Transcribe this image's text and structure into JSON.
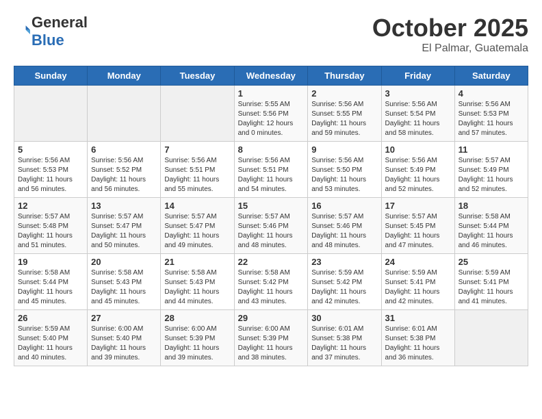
{
  "header": {
    "logo_general": "General",
    "logo_blue": "Blue",
    "month": "October 2025",
    "location": "El Palmar, Guatemala"
  },
  "days_of_week": [
    "Sunday",
    "Monday",
    "Tuesday",
    "Wednesday",
    "Thursday",
    "Friday",
    "Saturday"
  ],
  "weeks": [
    [
      {
        "day": "",
        "sunrise": "",
        "sunset": "",
        "daylight": ""
      },
      {
        "day": "",
        "sunrise": "",
        "sunset": "",
        "daylight": ""
      },
      {
        "day": "",
        "sunrise": "",
        "sunset": "",
        "daylight": ""
      },
      {
        "day": "1",
        "sunrise": "Sunrise: 5:55 AM",
        "sunset": "Sunset: 5:56 PM",
        "daylight": "Daylight: 12 hours and 0 minutes."
      },
      {
        "day": "2",
        "sunrise": "Sunrise: 5:56 AM",
        "sunset": "Sunset: 5:55 PM",
        "daylight": "Daylight: 11 hours and 59 minutes."
      },
      {
        "day": "3",
        "sunrise": "Sunrise: 5:56 AM",
        "sunset": "Sunset: 5:54 PM",
        "daylight": "Daylight: 11 hours and 58 minutes."
      },
      {
        "day": "4",
        "sunrise": "Sunrise: 5:56 AM",
        "sunset": "Sunset: 5:53 PM",
        "daylight": "Daylight: 11 hours and 57 minutes."
      }
    ],
    [
      {
        "day": "5",
        "sunrise": "Sunrise: 5:56 AM",
        "sunset": "Sunset: 5:53 PM",
        "daylight": "Daylight: 11 hours and 56 minutes."
      },
      {
        "day": "6",
        "sunrise": "Sunrise: 5:56 AM",
        "sunset": "Sunset: 5:52 PM",
        "daylight": "Daylight: 11 hours and 56 minutes."
      },
      {
        "day": "7",
        "sunrise": "Sunrise: 5:56 AM",
        "sunset": "Sunset: 5:51 PM",
        "daylight": "Daylight: 11 hours and 55 minutes."
      },
      {
        "day": "8",
        "sunrise": "Sunrise: 5:56 AM",
        "sunset": "Sunset: 5:51 PM",
        "daylight": "Daylight: 11 hours and 54 minutes."
      },
      {
        "day": "9",
        "sunrise": "Sunrise: 5:56 AM",
        "sunset": "Sunset: 5:50 PM",
        "daylight": "Daylight: 11 hours and 53 minutes."
      },
      {
        "day": "10",
        "sunrise": "Sunrise: 5:56 AM",
        "sunset": "Sunset: 5:49 PM",
        "daylight": "Daylight: 11 hours and 52 minutes."
      },
      {
        "day": "11",
        "sunrise": "Sunrise: 5:57 AM",
        "sunset": "Sunset: 5:49 PM",
        "daylight": "Daylight: 11 hours and 52 minutes."
      }
    ],
    [
      {
        "day": "12",
        "sunrise": "Sunrise: 5:57 AM",
        "sunset": "Sunset: 5:48 PM",
        "daylight": "Daylight: 11 hours and 51 minutes."
      },
      {
        "day": "13",
        "sunrise": "Sunrise: 5:57 AM",
        "sunset": "Sunset: 5:47 PM",
        "daylight": "Daylight: 11 hours and 50 minutes."
      },
      {
        "day": "14",
        "sunrise": "Sunrise: 5:57 AM",
        "sunset": "Sunset: 5:47 PM",
        "daylight": "Daylight: 11 hours and 49 minutes."
      },
      {
        "day": "15",
        "sunrise": "Sunrise: 5:57 AM",
        "sunset": "Sunset: 5:46 PM",
        "daylight": "Daylight: 11 hours and 48 minutes."
      },
      {
        "day": "16",
        "sunrise": "Sunrise: 5:57 AM",
        "sunset": "Sunset: 5:46 PM",
        "daylight": "Daylight: 11 hours and 48 minutes."
      },
      {
        "day": "17",
        "sunrise": "Sunrise: 5:57 AM",
        "sunset": "Sunset: 5:45 PM",
        "daylight": "Daylight: 11 hours and 47 minutes."
      },
      {
        "day": "18",
        "sunrise": "Sunrise: 5:58 AM",
        "sunset": "Sunset: 5:44 PM",
        "daylight": "Daylight: 11 hours and 46 minutes."
      }
    ],
    [
      {
        "day": "19",
        "sunrise": "Sunrise: 5:58 AM",
        "sunset": "Sunset: 5:44 PM",
        "daylight": "Daylight: 11 hours and 45 minutes."
      },
      {
        "day": "20",
        "sunrise": "Sunrise: 5:58 AM",
        "sunset": "Sunset: 5:43 PM",
        "daylight": "Daylight: 11 hours and 45 minutes."
      },
      {
        "day": "21",
        "sunrise": "Sunrise: 5:58 AM",
        "sunset": "Sunset: 5:43 PM",
        "daylight": "Daylight: 11 hours and 44 minutes."
      },
      {
        "day": "22",
        "sunrise": "Sunrise: 5:58 AM",
        "sunset": "Sunset: 5:42 PM",
        "daylight": "Daylight: 11 hours and 43 minutes."
      },
      {
        "day": "23",
        "sunrise": "Sunrise: 5:59 AM",
        "sunset": "Sunset: 5:42 PM",
        "daylight": "Daylight: 11 hours and 42 minutes."
      },
      {
        "day": "24",
        "sunrise": "Sunrise: 5:59 AM",
        "sunset": "Sunset: 5:41 PM",
        "daylight": "Daylight: 11 hours and 42 minutes."
      },
      {
        "day": "25",
        "sunrise": "Sunrise: 5:59 AM",
        "sunset": "Sunset: 5:41 PM",
        "daylight": "Daylight: 11 hours and 41 minutes."
      }
    ],
    [
      {
        "day": "26",
        "sunrise": "Sunrise: 5:59 AM",
        "sunset": "Sunset: 5:40 PM",
        "daylight": "Daylight: 11 hours and 40 minutes."
      },
      {
        "day": "27",
        "sunrise": "Sunrise: 6:00 AM",
        "sunset": "Sunset: 5:40 PM",
        "daylight": "Daylight: 11 hours and 39 minutes."
      },
      {
        "day": "28",
        "sunrise": "Sunrise: 6:00 AM",
        "sunset": "Sunset: 5:39 PM",
        "daylight": "Daylight: 11 hours and 39 minutes."
      },
      {
        "day": "29",
        "sunrise": "Sunrise: 6:00 AM",
        "sunset": "Sunset: 5:39 PM",
        "daylight": "Daylight: 11 hours and 38 minutes."
      },
      {
        "day": "30",
        "sunrise": "Sunrise: 6:01 AM",
        "sunset": "Sunset: 5:38 PM",
        "daylight": "Daylight: 11 hours and 37 minutes."
      },
      {
        "day": "31",
        "sunrise": "Sunrise: 6:01 AM",
        "sunset": "Sunset: 5:38 PM",
        "daylight": "Daylight: 11 hours and 36 minutes."
      },
      {
        "day": "",
        "sunrise": "",
        "sunset": "",
        "daylight": ""
      }
    ]
  ]
}
